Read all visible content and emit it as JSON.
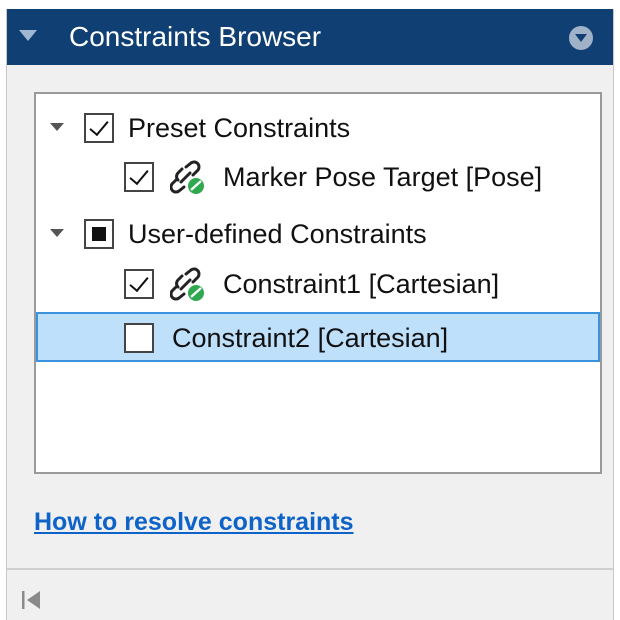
{
  "panel": {
    "title": "Constraints Browser",
    "title_collapse_icon": "triangle-down-icon",
    "title_menu_icon": "circle-chevron-down-icon",
    "header_color": "#0f3f73"
  },
  "tree": {
    "groups": [
      {
        "label": "Preset Constraints",
        "expanded": true,
        "check_state": "checked",
        "items": [
          {
            "label": "Marker Pose Target [Pose]",
            "checked": true,
            "icon": "link-active-icon"
          }
        ]
      },
      {
        "label": "User-defined Constraints",
        "expanded": true,
        "check_state": "partial",
        "items": [
          {
            "label": "Constraint1 [Cartesian]",
            "checked": true,
            "icon": "link-active-icon"
          },
          {
            "label": "Constraint2 [Cartesian]",
            "checked": false,
            "selected": true
          }
        ]
      }
    ],
    "selection_color": "#bfe0fb"
  },
  "help_link": {
    "text": "How to resolve constraints",
    "color": "#0e63c9"
  },
  "footer": {
    "collapse_icon": "collapse-left-icon"
  }
}
